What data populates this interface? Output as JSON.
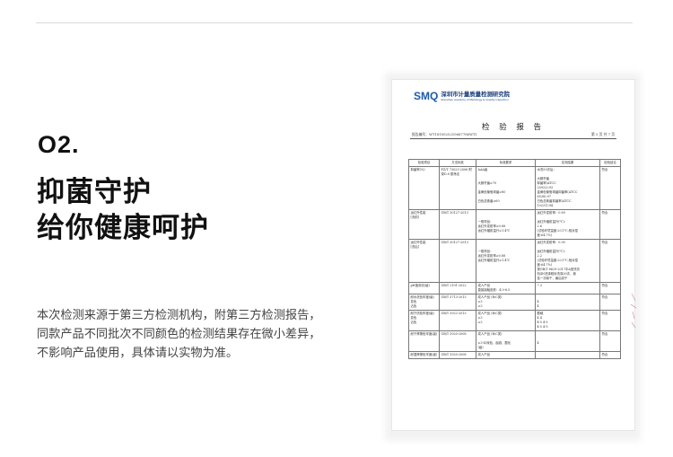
{
  "section": {
    "number": "O2.",
    "headline": [
      "抑菌守护",
      "给你健康呵护"
    ],
    "body": [
      "本次检测来源于第三方检测机构，附第三方检测报告，",
      "同款产品不同批次不同颜色的检测结果存在微小差异，",
      "不影响产品使用，具体请以实物为准。"
    ]
  },
  "report": {
    "logo": "SMQ",
    "org_cn": "深圳市计量质量检测研究院",
    "org_en": "Shenzhen Academy of Metrology & Quality Inspection",
    "title": "检 验 报 告",
    "report_no": "报告编号：WT1810025210667786WTI",
    "page": "第 5 页 共 7 页",
    "columns": [
      "检验项目",
      "方法标准",
      "标准要求",
      "实测结果",
      "检验结论"
    ],
    "rows": [
      {
        "item": [
          "抑菌率(%)"
        ],
        "method": [
          "FZ/T 73023-2006 附",
          "录D.8 振荡法"
        ],
        "requirement": [
          "AAA级",
          "",
          "",
          "大肠杆菌≥70",
          "",
          "金黄色葡萄球菌≥80",
          "",
          "白色念珠菌≥60"
        ],
        "result": [
          "水洗50次后：",
          "",
          "大肠杆菌",
          "抑菌率(ATCC",
          "25922):93",
          "金黄色葡萄球菌抑菌率(ATCC",
          "6538):97",
          "白色念珠菌抑菌率(ATCC",
          "10231):94"
        ],
        "conclusion": [
          "符合"
        ]
      },
      {
        "item": [
          "远红外性能",
          "[洗前]"
        ],
        "method": [
          "GB/T 30127-2013"
        ],
        "requirement": [
          "",
          "",
          "一般样品：",
          "远红外发射率≥0.88",
          "远红外辐射温升≥1.4℃"
        ],
        "result": [
          "远红外发射率：0.89",
          "",
          "远红外辐射温升(℃)：",
          "2.6",
          "(试验环境温度:20.1℃,相对湿",
          "度:64.7%)"
        ],
        "conclusion": [
          "符合"
        ]
      },
      {
        "item": [
          "远红外性能",
          "[洗后]"
        ],
        "method": [
          "GB/T 30127-2013"
        ],
        "requirement": [
          "",
          "",
          "一般样品：",
          "远红外发射率≥0.88",
          "远红外辐射温升≥1.4℃"
        ],
        "result": [
          "远红外发射率：0.90",
          "",
          "远红外辐射温升(℃)：",
          "2.2",
          "(试验环境温度:20.1℃,相对湿",
          "度:64.7%)",
          "按GB/T 8629-2017中A型洗衣",
          "机4N洗涤程序洗涤30次，悬",
          "挂一次晾干，最后烘干"
        ],
        "conclusion": [
          "符合"
        ]
      },
      {
        "item": [
          "耐水洗色牢度(级)",
          "变色",
          "沾色"
        ],
        "method": [
          "GB/T 3713-2013"
        ],
        "requirement": [
          "成人产品 (B/C类)",
          "≥3",
          "≥3"
        ],
        "result": [
          "",
          "4",
          "4"
        ],
        "conclusion": [
          "符合"
        ]
      },
      {
        "item": [
          "耐汗渍色牢度(级)",
          "变色",
          "沾色"
        ],
        "method": [
          "GB/T 3922-2013"
        ],
        "requirement": [
          "成人产品 (B/C类)",
          "≥3",
          "≥3"
        ],
        "result": [
          "酸碱",
          "4    4",
          "4-5  4-5",
          "4-5  4-5"
        ],
        "conclusion": [
          "符合"
        ]
      },
      {
        "item": [
          "耐干摩擦色牢度(级)"
        ],
        "method": [
          "GB/T 3920-2008"
        ],
        "requirement": [
          "成人产品 (B/C类)",
          "",
          "≥3-4(深色、起绒、酸化",
          "(级)"
        ],
        "result": [
          "",
          "",
          "4"
        ],
        "conclusion": [
          "符合"
        ]
      },
      {
        "item": [
          "耐湿摩擦色牢度(级)"
        ],
        "method": [
          "GB/T 3920-2008"
        ],
        "requirement": [
          "成人产品"
        ],
        "result": [
          ""
        ],
        "conclusion": [
          "符合"
        ]
      }
    ],
    "extra_row": {
      "item": [
        "pH值测试(级)"
      ],
      "method": [
        "GB/T 2101-2022"
      ],
      "requirement": [
        "成人产品",
        "直接接触皮肤：4.0-8.5"
      ],
      "result": [
        "7.3"
      ],
      "conclusion": [
        "符合"
      ]
    }
  }
}
